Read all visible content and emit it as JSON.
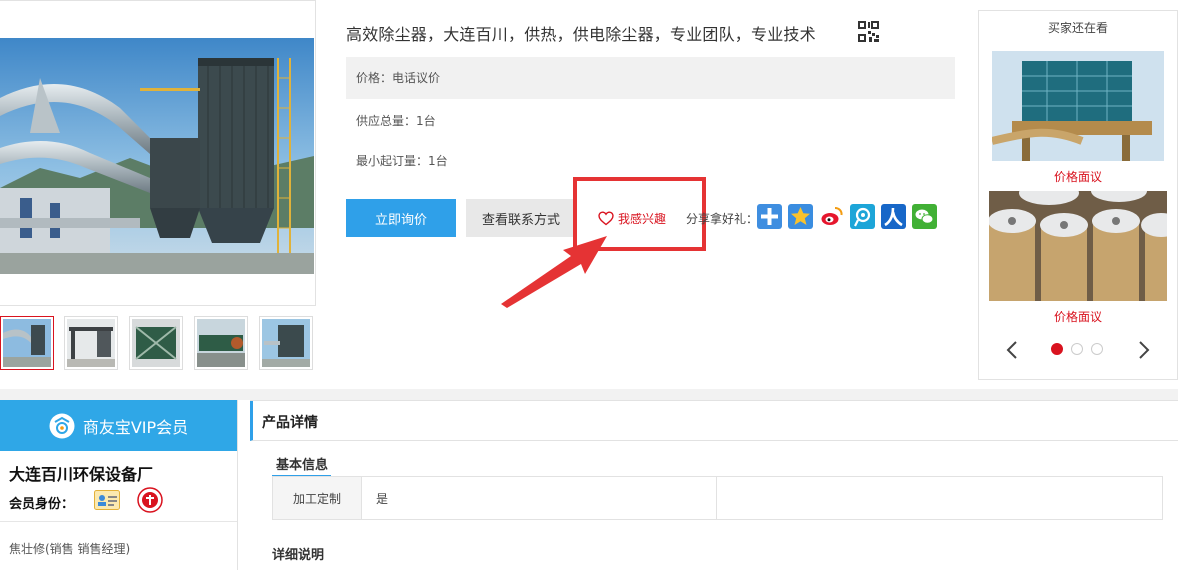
{
  "product": {
    "title": "高效除尘器，大连百川，供热，供电除尘器，专业团队，专业技术",
    "price": "价格：电话议价",
    "supply_total": "供应总量：1台",
    "min_order": "最小起订量：1台"
  },
  "actions": {
    "inquiry_label": "立即询价",
    "contact_label": "查看联系方式",
    "interest_label": "我感兴趣",
    "share_label": "分享拿好礼：",
    "share_icons": [
      "plus-share-icon",
      "qzone-icon",
      "weibo-icon",
      "tencent-weibo-icon",
      "renren-icon",
      "wechat-icon"
    ]
  },
  "side": {
    "title": "买家还在看",
    "items": [
      {
        "price": "价格面议"
      },
      {
        "price": "价格面议"
      }
    ],
    "dots": 3,
    "active_dot": 0
  },
  "company": {
    "vip_label": "商友宝VIP会员",
    "name": "大连百川环保设备厂",
    "member_label": "会员身份：",
    "contact": "焦壮修(销售  销售经理)"
  },
  "detail": {
    "header": "产品详情",
    "basic_tab": "基本信息",
    "attributes": [
      {
        "key": "加工定制",
        "value": "是"
      }
    ],
    "description_heading": "详细说明"
  },
  "colors": {
    "accent_blue": "#2fa0e9",
    "vip_blue": "#2fa7e7",
    "price_red": "#d9131f",
    "annotation_red": "#e53334"
  }
}
